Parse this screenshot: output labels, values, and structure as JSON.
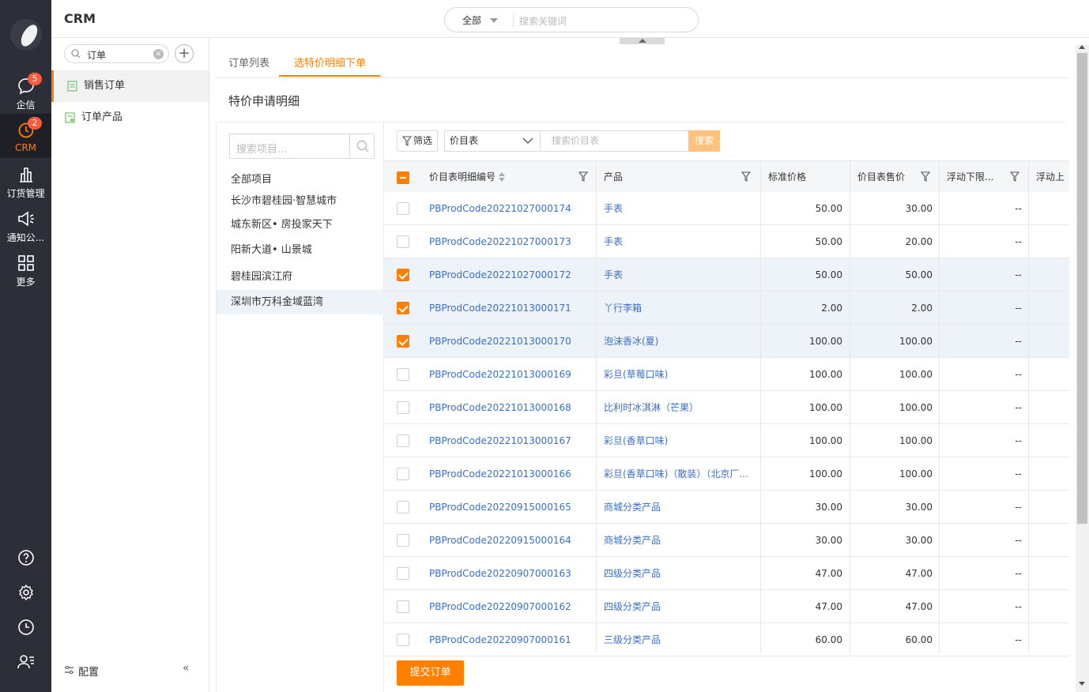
{
  "app": {
    "title": "CRM"
  },
  "rail": {
    "items": [
      {
        "label": "企信",
        "icon": "chat-icon",
        "badge": "5"
      },
      {
        "label": "CRM",
        "icon": "crm-icon",
        "badge": "2"
      },
      {
        "label": "订货管理",
        "icon": "chart-icon",
        "badge": ""
      },
      {
        "label": "通知公...",
        "icon": "megaphone-icon",
        "badge": ""
      },
      {
        "label": "更多",
        "icon": "grid-icon",
        "badge": ""
      }
    ],
    "bottom_icons": [
      "help-icon",
      "settings-icon",
      "history-icon",
      "contacts-icon"
    ]
  },
  "search": {
    "scope": "全部",
    "placeholder": "搜索关键词"
  },
  "sidebar": {
    "search_value": "订单",
    "items": [
      {
        "label": "销售订单",
        "active": true
      },
      {
        "label": "订单产品",
        "active": false
      }
    ],
    "config_label": "配置",
    "collapse_label": "«"
  },
  "tabs": [
    {
      "label": "订单列表",
      "active": false
    },
    {
      "label": "选特价明细下单",
      "active": true
    }
  ],
  "section_title": "特价申请明细",
  "projects": {
    "search_placeholder": "搜索项目...",
    "items": [
      {
        "label": "全部项目",
        "active": false
      },
      {
        "label": "长沙市碧桂园·智慧城市",
        "active": false
      },
      {
        "label": "城东新区• 房投家天下",
        "active": false
      },
      {
        "label": "阳新大道• 山景城",
        "active": false
      },
      {
        "label": "碧桂园滨江府",
        "active": false
      },
      {
        "label": "深圳市万科金域蓝湾",
        "active": true
      }
    ]
  },
  "toolbar": {
    "filter_label": "筛选",
    "pricebook_select": "价目表",
    "pricebook_placeholder": "搜索价目表",
    "search_button": "搜索"
  },
  "table": {
    "columns": [
      "价目表明细编号",
      "产品",
      "标准价格",
      "价目表售价",
      "浮动下限...",
      "浮动上"
    ],
    "rows": [
      {
        "code": "PBProdCode20221027000174",
        "product": "手表",
        "std": "50.00",
        "price": "30.00",
        "lower": "--",
        "checked": false
      },
      {
        "code": "PBProdCode20221027000173",
        "product": "手表",
        "std": "50.00",
        "price": "20.00",
        "lower": "--",
        "checked": false
      },
      {
        "code": "PBProdCode20221027000172",
        "product": "手表",
        "std": "50.00",
        "price": "50.00",
        "lower": "--",
        "checked": true
      },
      {
        "code": "PBProdCode20221013000171",
        "product": "丫行李箱",
        "std": "2.00",
        "price": "2.00",
        "lower": "--",
        "checked": true
      },
      {
        "code": "PBProdCode20221013000170",
        "product": "泡沫香冰(夏)",
        "std": "100.00",
        "price": "100.00",
        "lower": "--",
        "checked": true
      },
      {
        "code": "PBProdCode20221013000169",
        "product": "彩旦(草莓口味)",
        "std": "100.00",
        "price": "100.00",
        "lower": "--",
        "checked": false
      },
      {
        "code": "PBProdCode20221013000168",
        "product": "比利时冰淇淋（芒果）",
        "std": "100.00",
        "price": "100.00",
        "lower": "--",
        "checked": false
      },
      {
        "code": "PBProdCode20221013000167",
        "product": "彩旦(香草口味)",
        "std": "100.00",
        "price": "100.00",
        "lower": "--",
        "checked": false
      },
      {
        "code": "PBProdCode20221013000166",
        "product": "彩旦(香草口味)（散装）（北京厂...",
        "std": "100.00",
        "price": "100.00",
        "lower": "--",
        "checked": false
      },
      {
        "code": "PBProdCode20220915000165",
        "product": "商城分类产品",
        "std": "30.00",
        "price": "30.00",
        "lower": "--",
        "checked": false
      },
      {
        "code": "PBProdCode20220915000164",
        "product": "商城分类产品",
        "std": "30.00",
        "price": "30.00",
        "lower": "--",
        "checked": false
      },
      {
        "code": "PBProdCode20220907000163",
        "product": "四级分类产品",
        "std": "47.00",
        "price": "47.00",
        "lower": "--",
        "checked": false
      },
      {
        "code": "PBProdCode20220907000162",
        "product": "四级分类产品",
        "std": "47.00",
        "price": "47.00",
        "lower": "--",
        "checked": false
      },
      {
        "code": "PBProdCode20220907000161",
        "product": "三级分类产品",
        "std": "60.00",
        "price": "60.00",
        "lower": "--",
        "checked": false
      }
    ]
  },
  "submit_label": "提交订单",
  "colors": {
    "accent": "#ff8000",
    "link": "#3a70c6",
    "rail": "#2d2f38"
  }
}
